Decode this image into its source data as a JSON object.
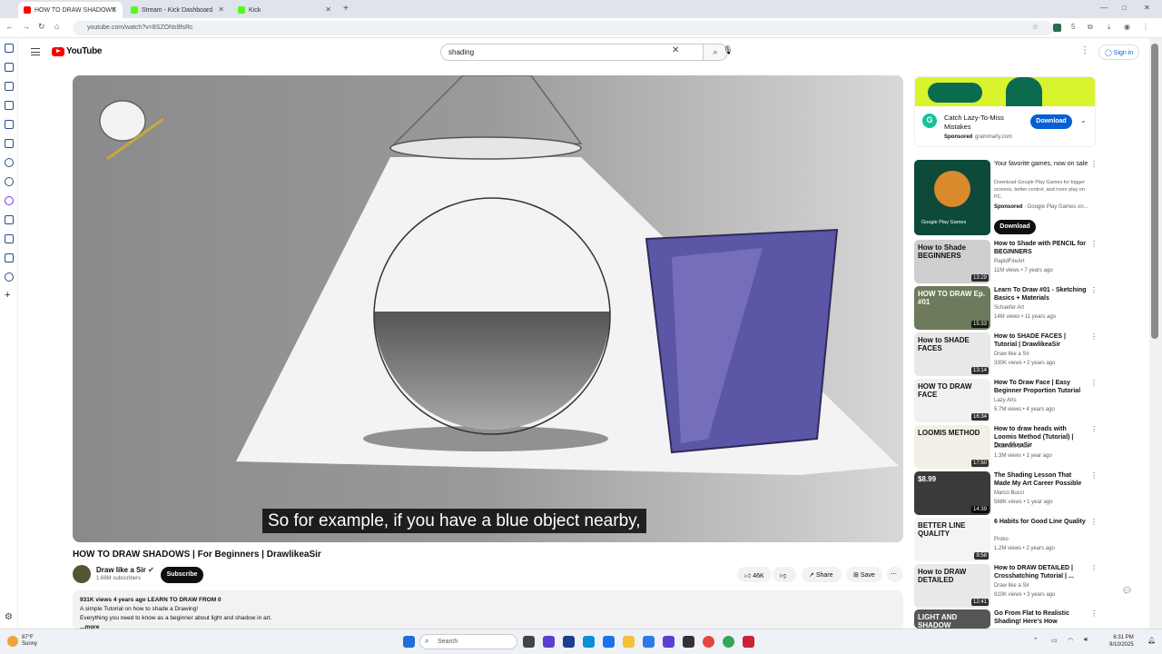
{
  "browser": {
    "tabs": [
      {
        "title": "HOW TO DRAW SHADOWS",
        "active": true,
        "favicon_color": "#ff0000"
      },
      {
        "title": "Stream - Kick Dashboard",
        "active": false,
        "favicon_color": "#53fc18"
      },
      {
        "title": "Kick",
        "active": false,
        "favicon_color": "#53fc18"
      }
    ],
    "new_tab": "+",
    "url": "youtube.com/watch?v=8SZONs9fsRc"
  },
  "youtube": {
    "logo_text": "YouTube",
    "search_value": "shading",
    "sign_in": "Sign in",
    "caption": "So for example, if you have a blue object nearby,",
    "video_title": "HOW TO DRAW SHADOWS | For Beginners | DrawlikeaSir",
    "channel": "Draw like a Sir",
    "subscribers": "1.68M subscribers",
    "subscribe": "Subscribe",
    "likes": "46K",
    "share": "Share",
    "save": "Save",
    "desc_meta": "931K views  4 years ago  LEARN TO DRAW FROM 0",
    "desc_line1": "A simple Tutorial on how to shade a Drawing!",
    "desc_line2": "Everything you need to know as a beginner about light and shadow in art.",
    "desc_more": "...more"
  },
  "ad": {
    "title": "Catch Lazy-To-Miss Mistakes",
    "sponsor": "Sponsored",
    "domain": "grammarly.com",
    "cta": "Download"
  },
  "ad2": {
    "title": "Your favorite games, now on sale",
    "desc": "Download Google Play Games for bigger screens, better control, and more play on PC.",
    "sponsor": "Sponsored",
    "advertiser": "Google Play Games on...",
    "cta": "Download",
    "thumb_label": "Google Play Games"
  },
  "recommendations": [
    {
      "title": "How to Shade with PENCIL for BEGINNERS",
      "channel": "RapidFireArt",
      "meta": "11M views • 7 years ago",
      "duration": "13:29",
      "thumb_text": "How to Shade BEGINNERS",
      "thumb_color": "#cfcfcf"
    },
    {
      "title": "Learn To Draw #01 - Sketching Basics + Materials",
      "channel": "Schaefer Art",
      "meta": "14M views • 11 years ago",
      "duration": "15:33",
      "thumb_text": "HOW TO DRAW Ep. #01",
      "thumb_color": "#6d7a5c"
    },
    {
      "title": "How to SHADE FACES | Tutorial | DrawlikeaSir",
      "channel": "Draw like a Sir",
      "meta": "330K views • 2 years ago",
      "duration": "13:14",
      "thumb_text": "How to SHADE FACES",
      "thumb_color": "#e8e8e8"
    },
    {
      "title": "How To Draw Face | Easy Beginner Proportion Tutorial",
      "channel": "Lazy Arts",
      "meta": "5.7M views • 4 years ago",
      "duration": "16:34",
      "thumb_text": "HOW TO DRAW FACE",
      "thumb_color": "#f1f1f1"
    },
    {
      "title": "How to draw heads with Loomis Method (Tutorial) | DrawlikeaSir",
      "channel": "Draw like a Sir",
      "meta": "1.3M views • 1 year ago",
      "duration": "17:50",
      "thumb_text": "LOOMIS METHOD",
      "thumb_color": "#f4efe6"
    },
    {
      "title": "The Shading Lesson That Made My Art Career Possible",
      "channel": "Marco Bucci",
      "meta": "568K views • 1 year ago",
      "duration": "14:39",
      "thumb_text": "$8.99",
      "thumb_color": "#3a3a3a"
    },
    {
      "title": "6 Habits for Good Line Quality",
      "channel": "Proko",
      "meta": "1.2M views • 2 years ago",
      "duration": "9:58",
      "thumb_text": "BETTER LINE QUALITY",
      "thumb_color": "#f4f4f4"
    },
    {
      "title": "How to DRAW DETAILED | Crosshatching Tutorial | ...",
      "channel": "Draw like a Sir",
      "meta": "910K views • 3 years ago",
      "duration": "12:41",
      "thumb_text": "How to DRAW DETAILED",
      "thumb_color": "#e9e9e9"
    },
    {
      "title": "Go From Flat to Realistic Shading! Here's How",
      "channel": "",
      "meta": "",
      "duration": "",
      "thumb_text": "LIGHT AND SHADOW",
      "thumb_color": "#555555"
    }
  ],
  "taskbar": {
    "temperature": "87°F",
    "weather": "Sunny",
    "search_placeholder": "Search",
    "time": "6:31 PM",
    "date": "9/10/2025"
  }
}
